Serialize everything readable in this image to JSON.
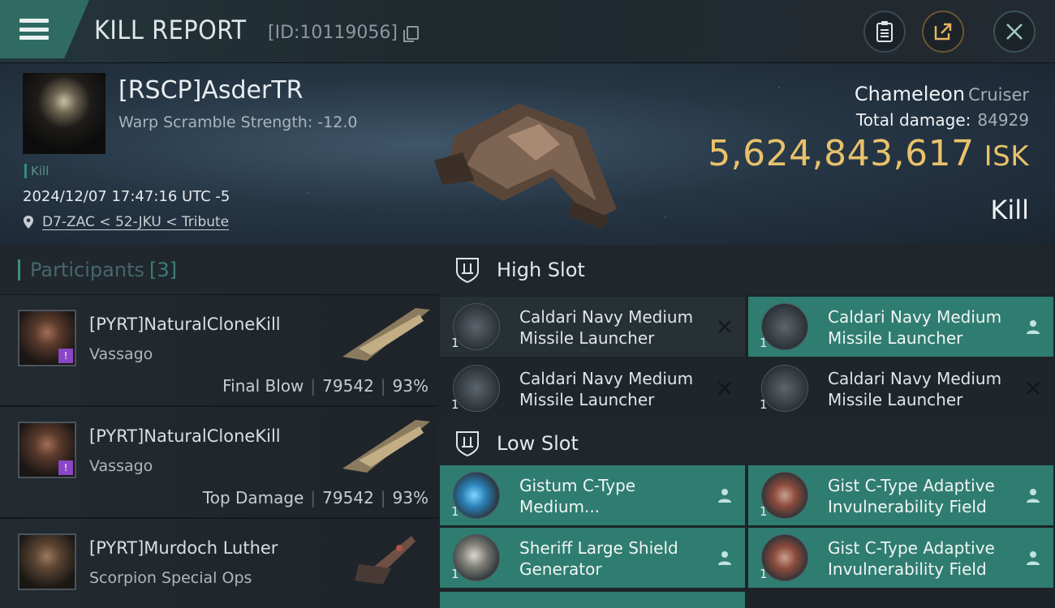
{
  "header": {
    "title": "KILL REPORT",
    "id": "[ID:10119056]",
    "buttons": [
      "clipboard-icon",
      "share-icon",
      "close-icon"
    ]
  },
  "victim": {
    "name": "[RSCP]AsderTR",
    "warp": "Warp Scramble Strength: -12.0",
    "tag": "Kill",
    "datetime": "2024/12/07 17:47:16 UTC -5",
    "location": "D7-ZAC < 52-JKU < Tribute",
    "ship_name": "Chameleon",
    "ship_class": "Cruiser",
    "damage_label": "Total damage:",
    "damage_value": "84929",
    "isk_value": "5,624,843,617",
    "isk_unit": "ISK",
    "result": "Kill"
  },
  "participants": {
    "title": "Participants",
    "count": "[3]",
    "rows": [
      {
        "name": "[PYRT]NaturalCloneKill",
        "ship": "Vassago",
        "role": "Final Blow",
        "damage": "79542",
        "percent": "93%"
      },
      {
        "name": "[PYRT]NaturalCloneKill",
        "ship": "Vassago",
        "role": "Top Damage",
        "damage": "79542",
        "percent": "93%"
      },
      {
        "name": "[PYRT]Murdoch Luther",
        "ship": "Scorpion Special Ops"
      }
    ]
  },
  "high_slot": {
    "title": "High Slot",
    "modules": [
      {
        "qty": "1",
        "name": "Caldari Navy Medium Missile Launcher",
        "status": "destroyed"
      },
      {
        "qty": "1",
        "name": "Caldari Navy Medium Missile Launcher",
        "status": "dropped"
      },
      {
        "qty": "1",
        "name": "Caldari Navy Medium Missile Launcher",
        "status": "destroyed"
      },
      {
        "qty": "1",
        "name": "Caldari Navy Medium Missile Launcher",
        "status": "destroyed"
      }
    ]
  },
  "low_slot": {
    "title": "Low Slot",
    "modules": [
      {
        "qty": "1",
        "name": "Gistum C-Type Medium...",
        "status": "dropped"
      },
      {
        "qty": "1",
        "name": "Gist C-Type Adaptive Invulnerability Field",
        "status": "dropped"
      },
      {
        "qty": "1",
        "name": "Sheriff Large Shield Generator",
        "status": "dropped"
      },
      {
        "qty": "1",
        "name": "Gist C-Type Adaptive Invulnerability Field",
        "status": "dropped"
      }
    ]
  },
  "colors": {
    "accent": "#2f7d70",
    "isk": "#e8c26a",
    "background": "#1b2026"
  }
}
